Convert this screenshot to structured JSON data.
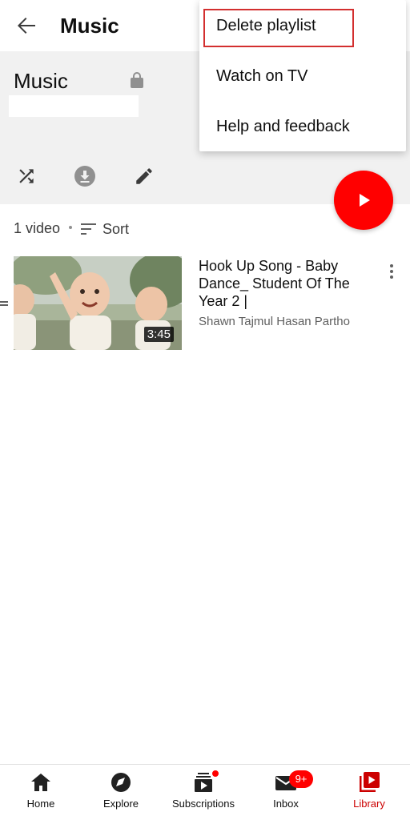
{
  "appbar": {
    "title": "Music"
  },
  "playlist": {
    "title": "Music"
  },
  "list": {
    "count": "1 video",
    "sort_label": "Sort"
  },
  "video": {
    "title": "Hook Up Song - Baby Dance_ Student Of The Year 2 |",
    "channel": "Shawn Tajmul Hasan Partho",
    "duration": "3:45"
  },
  "menu": {
    "items": [
      {
        "label": "Delete playlist"
      },
      {
        "label": "Watch on TV"
      },
      {
        "label": "Help and feedback"
      }
    ]
  },
  "nav": {
    "items": [
      {
        "label": "Home",
        "icon": "home-icon"
      },
      {
        "label": "Explore",
        "icon": "compass-icon"
      },
      {
        "label": "Subscriptions",
        "icon": "subscriptions-icon"
      },
      {
        "label": "Inbox",
        "icon": "mail-icon"
      },
      {
        "label": "Library",
        "icon": "library-icon"
      }
    ],
    "inbox_badge": "9+",
    "active": "Library"
  },
  "colors": {
    "accent": "#ff0000",
    "active_nav": "#cc0000",
    "highlight_border": "#d32f2f"
  }
}
